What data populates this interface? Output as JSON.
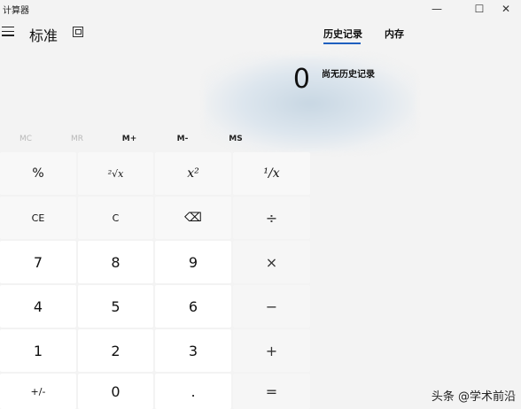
{
  "window": {
    "title": "计算器",
    "controls": {
      "minimize": "—",
      "maximize": "☐",
      "close": "✕"
    }
  },
  "header": {
    "mode_title": "标准"
  },
  "display": {
    "value": "0"
  },
  "side_panel": {
    "tabs": [
      {
        "label": "历史记录"
      },
      {
        "label": "内存"
      }
    ],
    "history_empty": "尚无历史记录"
  },
  "memory": {
    "buttons": [
      {
        "label": "MC",
        "enabled": false
      },
      {
        "label": "MR",
        "enabled": false
      },
      {
        "label": "M+",
        "enabled": true
      },
      {
        "label": "M-",
        "enabled": true
      },
      {
        "label": "MS",
        "enabled": true
      }
    ]
  },
  "keys": {
    "percent": "%",
    "sqrt": "²√x",
    "square": "x²",
    "reciprocal": "¹/x",
    "ce": "CE",
    "c": "C",
    "backspace": "⌫",
    "divide": "÷",
    "seven": "7",
    "eight": "8",
    "nine": "9",
    "multiply": "×",
    "four": "4",
    "five": "5",
    "six": "6",
    "minus": "−",
    "one": "1",
    "two": "2",
    "three": "3",
    "plus": "+",
    "negate": "+/-",
    "zero": "0",
    "decimal": ".",
    "equals": "="
  },
  "watermark": "头条 @学术前沿"
}
